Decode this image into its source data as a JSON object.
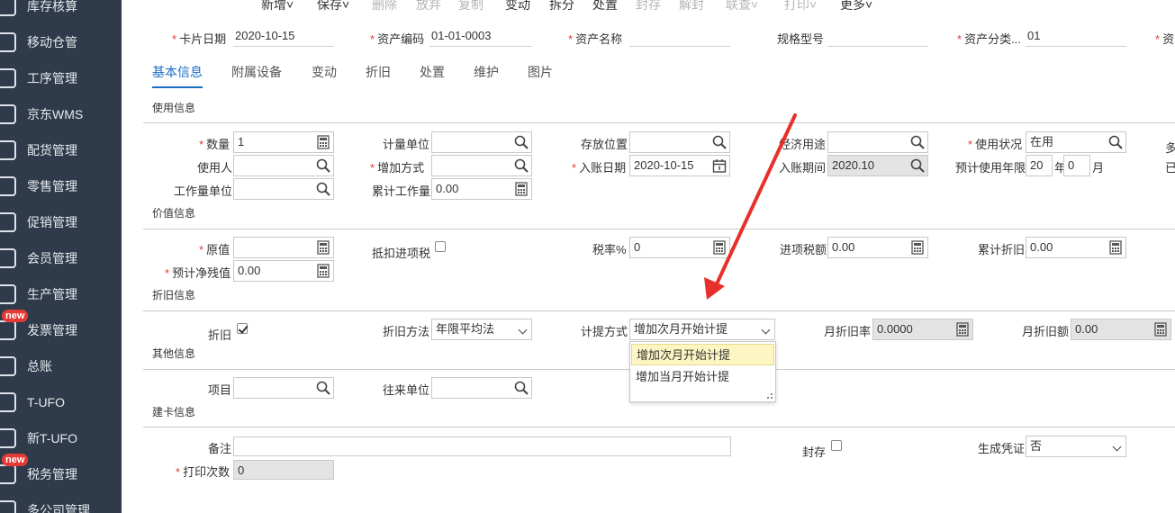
{
  "sidebar": {
    "items": [
      {
        "label": "库存核算",
        "icon": "inventory-icon"
      },
      {
        "label": "移动仓管",
        "icon": "cloud-warehouse-icon"
      },
      {
        "label": "工序管理",
        "icon": "process-icon"
      },
      {
        "label": "京东WMS",
        "icon": "truck-icon"
      },
      {
        "label": "配货管理",
        "icon": "distribution-icon"
      },
      {
        "label": "零售管理",
        "icon": "retail-icon"
      },
      {
        "label": "促销管理",
        "icon": "megaphone-icon"
      },
      {
        "label": "会员管理",
        "icon": "member-icon"
      },
      {
        "label": "生产管理",
        "icon": "production-icon"
      },
      {
        "label": "发票管理",
        "icon": "invoice-icon",
        "badge": "new"
      },
      {
        "label": "总账",
        "icon": "ledger-icon"
      },
      {
        "label": "T-UFO",
        "icon": "report-icon"
      },
      {
        "label": "新T-UFO",
        "icon": "report-grid-icon"
      },
      {
        "label": "税务管理",
        "icon": "tax-icon",
        "badge": "new"
      },
      {
        "label": "多公司管理",
        "icon": "multi-company-icon"
      }
    ]
  },
  "toolbar": {
    "items": [
      {
        "label": "新增˅",
        "enabled": true
      },
      {
        "label": "保存˅",
        "enabled": true
      },
      {
        "label": "删除",
        "enabled": false
      },
      {
        "label": "放弃",
        "enabled": false
      },
      {
        "label": "复制",
        "enabled": false
      },
      {
        "label": "变动",
        "enabled": true
      },
      {
        "label": "拆分",
        "enabled": true
      },
      {
        "label": "处置",
        "enabled": true
      },
      {
        "label": "封存",
        "enabled": false
      },
      {
        "label": "解封",
        "enabled": false
      },
      {
        "label": "联查˅",
        "enabled": false
      },
      {
        "label": "打印˅",
        "enabled": false
      },
      {
        "label": "更多˅",
        "enabled": true
      }
    ]
  },
  "header": {
    "card_date_label": "卡片日期",
    "card_date": "2020-10-15",
    "asset_code_label": "资产编码",
    "asset_code": "01-01-0003",
    "asset_name_label": "资产名称",
    "asset_name": "",
    "spec_label": "规格型号",
    "spec": "",
    "asset_class_label": "资产分类...",
    "asset_class": "01",
    "cut_label": "资"
  },
  "tabs": [
    "基本信息",
    "附属设备",
    "变动",
    "折旧",
    "处置",
    "维护",
    "图片"
  ],
  "sections": {
    "usage": "使用信息",
    "value": "价值信息",
    "depreciation": "折旧信息",
    "other": "其他信息",
    "build": "建卡信息"
  },
  "usage": {
    "qty_label": "数量",
    "qty": "1",
    "unit_label": "计量单位",
    "unit": "",
    "location_label": "存放位置",
    "location": "",
    "econ_use_label": "经济用途",
    "econ_use": "",
    "status_label": "使用状况",
    "status": "在用",
    "more_cut": "多",
    "user_label": "使用人",
    "user": "",
    "add_method_label": "增加方式",
    "add_method": "",
    "entry_date_label": "入账日期",
    "entry_date": "2020-10-15",
    "entry_period_label": "入账期间",
    "entry_period": "2020.10",
    "life_label": "预计使用年限",
    "life_years": "20",
    "year_unit": "年",
    "life_months": "0",
    "month_unit": "月",
    "done_cut": "已",
    "workload_unit_label": "工作量单位",
    "workload_unit": "",
    "acc_workload_label": "累计工作量",
    "acc_workload": "0.00"
  },
  "value": {
    "orig_label": "原值",
    "orig": "",
    "deduct_label": "抵扣进项税",
    "tax_rate_label": "税率%",
    "tax_rate": "0",
    "input_tax_label": "进项税额",
    "input_tax": "0.00",
    "acc_dep_label": "累计折旧",
    "acc_dep": "0.00",
    "residual_label": "预计净残值",
    "residual": "0.00"
  },
  "depreciation": {
    "dep_label": "折旧",
    "method_label": "折旧方法",
    "method": "年限平均法",
    "calc_label": "计提方式",
    "calc": "增加次月开始计提",
    "month_rate_label": "月折旧率",
    "month_rate": "0.0000",
    "month_amount_label": "月折旧额",
    "month_amount": "0.00",
    "calc_options": [
      "增加次月开始计提",
      "增加当月开始计提"
    ]
  },
  "other": {
    "project_label": "项目",
    "project": "",
    "partner_label": "往来单位",
    "partner": ""
  },
  "build": {
    "remark_label": "备注",
    "remark": "",
    "seal_label": "封存",
    "voucher_label": "生成凭证",
    "voucher": "否",
    "print_count_label": "打印次数",
    "print_count": "0"
  },
  "colors": {
    "accent": "#1a6fc4",
    "sidebar": "#2f3a4a",
    "required": "#e53935",
    "arrow": "#e8302a"
  }
}
